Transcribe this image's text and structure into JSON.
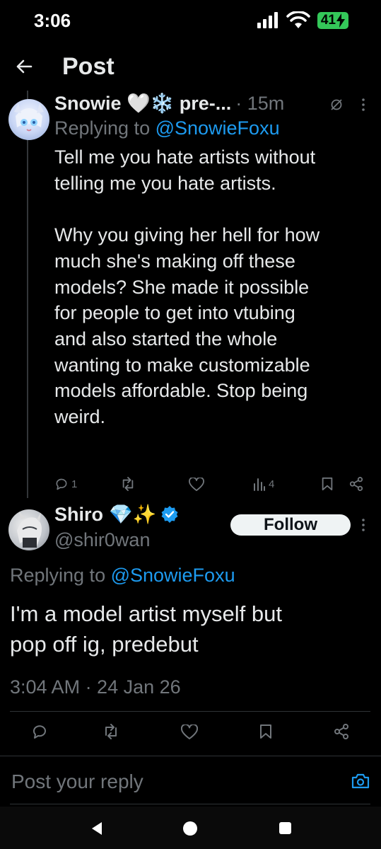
{
  "status_bar": {
    "time": "3:06",
    "battery": "41"
  },
  "header": {
    "title": "Post"
  },
  "parent_tweet": {
    "name": "Snowie 🤍❄️ pre-...",
    "time": "· 15m",
    "replying_prefix": "Replying to ",
    "replying_handle": "@SnowieFoxu",
    "text": "Tell me you hate artists without\ntelling me you hate artists.\n\nWhy you giving her hell for how\nmuch she's making off these\nmodels? She made it possible\nfor people to get into vtubing\nand also started the whole\nwanting to make customizable\nmodels affordable. Stop being\nweird.",
    "reply_count": "1",
    "views_count": "4"
  },
  "main_tweet": {
    "name": "Shiro",
    "name_emojis": "💎✨",
    "handle": "@shir0wan",
    "follow_label": "Follow",
    "replying_prefix": "Replying to ",
    "replying_handle": "@SnowieFoxu",
    "text": "I'm a model artist myself but\npop off ig, predebut",
    "timestamp": "3:04 AM · 24 Jan 26"
  },
  "reply_bar": {
    "placeholder": "Post your reply"
  },
  "colors": {
    "accent": "#1d9bf0",
    "muted": "#71767b",
    "background": "#000000"
  }
}
